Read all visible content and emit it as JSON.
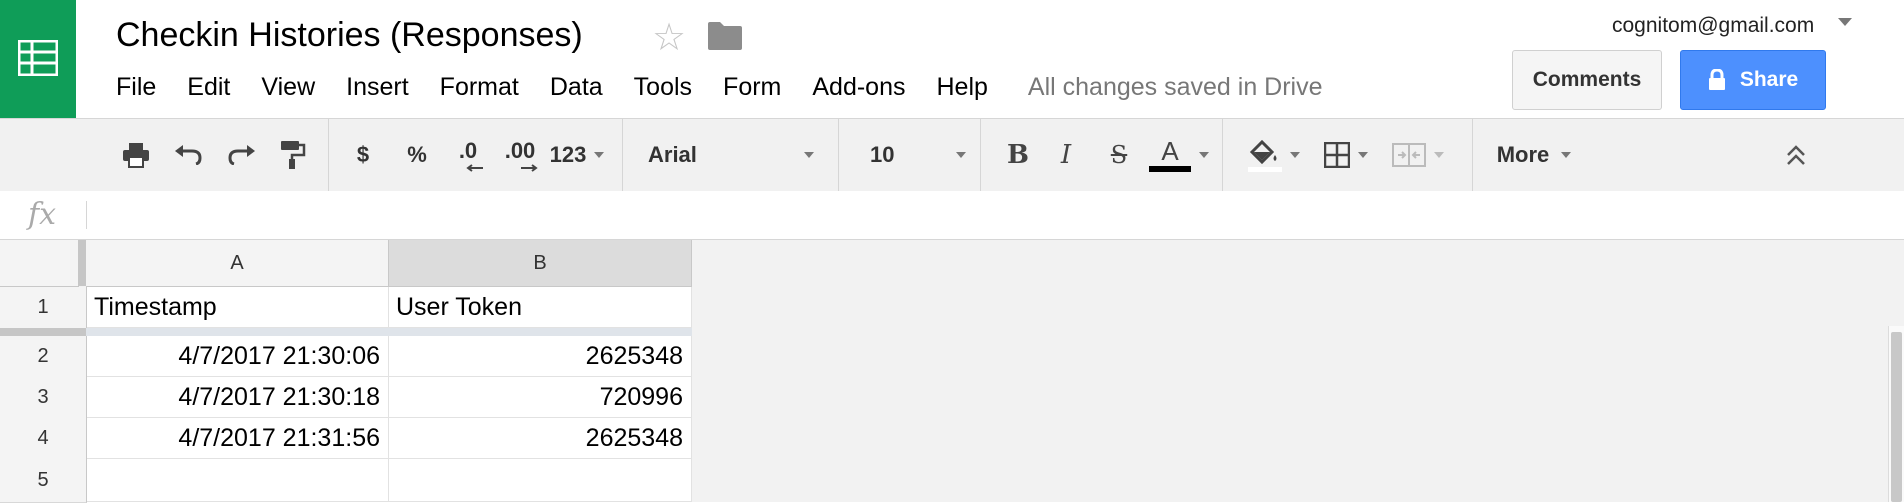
{
  "app": {
    "brand_color": "#0f9d58",
    "logo_icon": "sheets-grid-icon"
  },
  "header": {
    "title": "Checkin Histories (Responses)",
    "star_icon": "star-outline-icon",
    "folder_icon": "folder-icon",
    "account_email": "cognitom@gmail.com",
    "comments_label": "Comments",
    "share_label": "Share",
    "share_color": "#4d90fe"
  },
  "menu": {
    "items": [
      "File",
      "Edit",
      "View",
      "Insert",
      "Format",
      "Data",
      "Tools",
      "Form",
      "Add-ons",
      "Help"
    ],
    "status": "All changes saved in Drive"
  },
  "toolbar": {
    "currency": "$",
    "percent": "%",
    "decrease_decimal": ".0",
    "increase_decimal": ".00",
    "number_format": "123",
    "font_family": "Arial",
    "font_size": "10",
    "bold": "B",
    "italic": "I",
    "strike": "S",
    "text_color": "A",
    "more_label": "More"
  },
  "formula_bar": {
    "fx": "fx",
    "value": ""
  },
  "grid": {
    "columns": [
      "A",
      "B"
    ],
    "rows": [
      "1",
      "2",
      "3",
      "4",
      "5"
    ],
    "cells": [
      [
        "Timestamp",
        "User Token"
      ],
      [
        "4/7/2017 21:30:06",
        "2625348"
      ],
      [
        "4/7/2017 21:30:18",
        "720996"
      ],
      [
        "4/7/2017 21:31:56",
        "2625348"
      ],
      [
        "",
        ""
      ]
    ]
  }
}
